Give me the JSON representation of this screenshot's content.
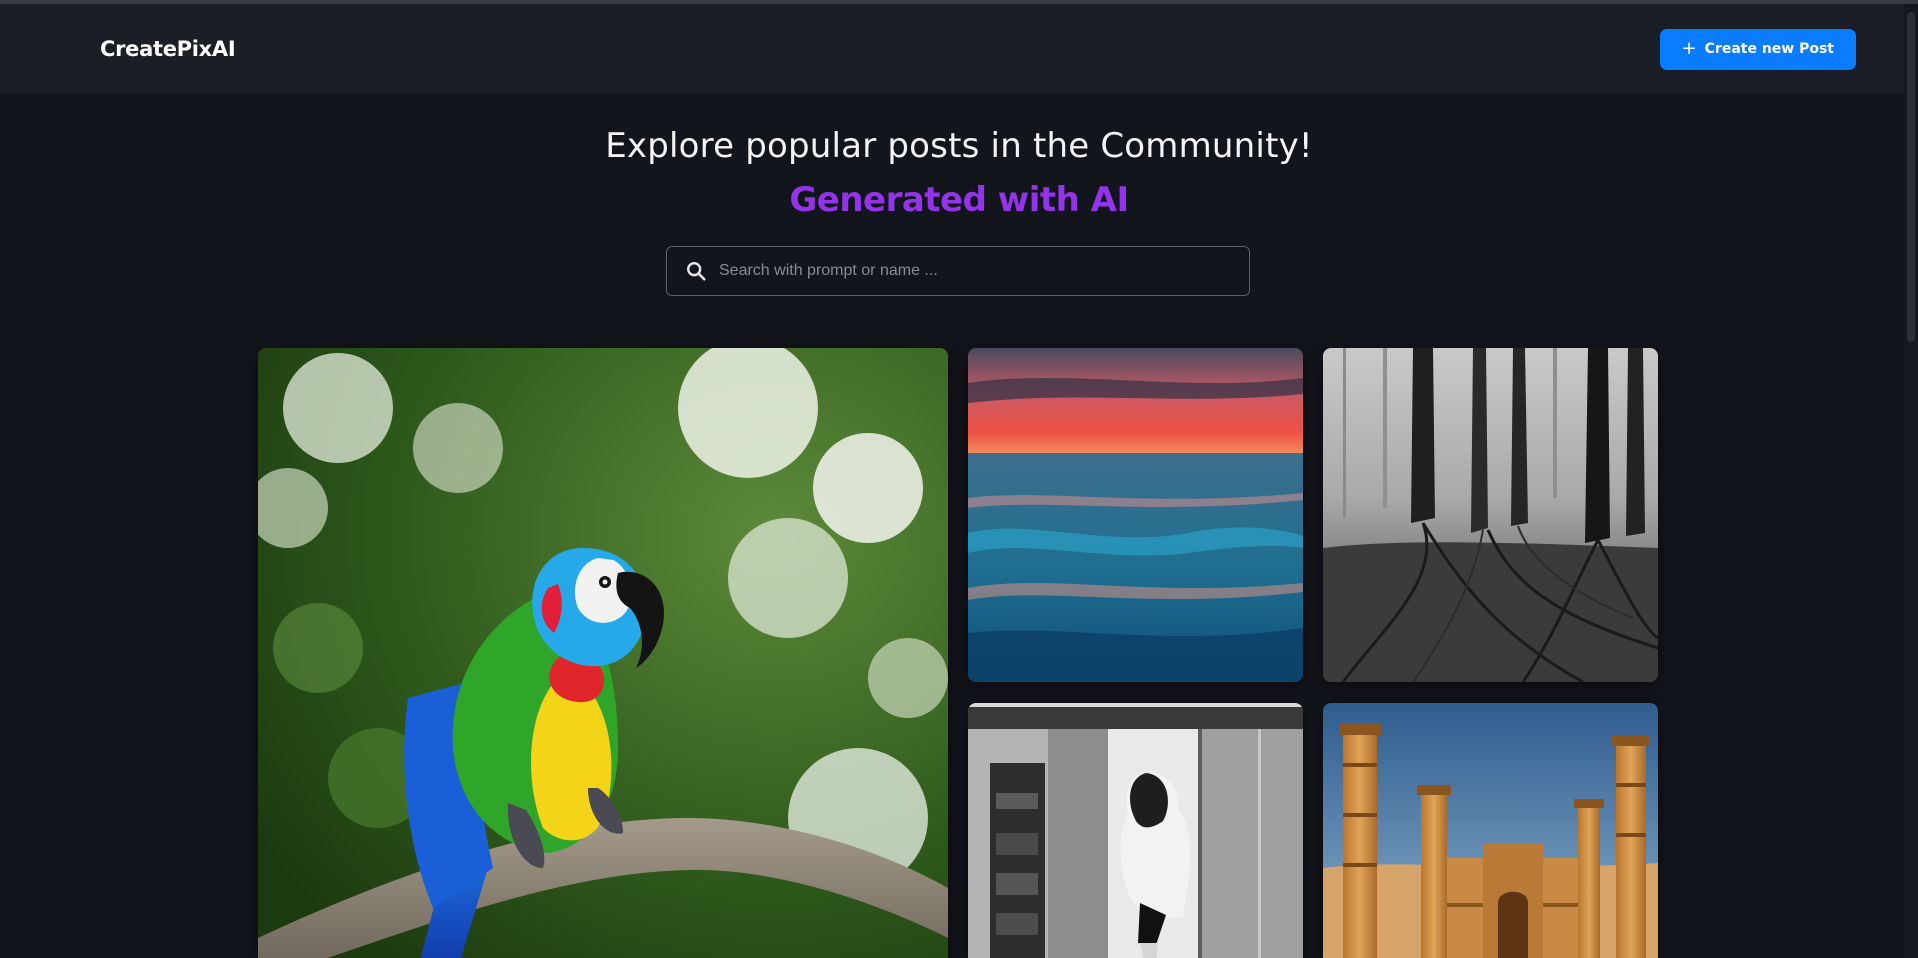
{
  "app": {
    "name": "CreatePixAI"
  },
  "header": {
    "create_button": {
      "label": "Create new Post",
      "icon": "plus-icon"
    }
  },
  "hero": {
    "title": "Explore popular posts in the Community!",
    "subtitle": "Generated with AI"
  },
  "search": {
    "placeholder": "Search with prompt or name ...",
    "value": "",
    "icon": "search-icon"
  },
  "colors": {
    "background": "#13151c",
    "header": "#1b1e27",
    "accent_button": "#0a7cff",
    "subtitle": "#9333ea"
  },
  "posts": [
    {
      "image": "parrot-macaw"
    },
    {
      "image": "ocean-sunset-waves"
    },
    {
      "image": "foggy-forest-bw"
    },
    {
      "image": "woman-doorway-bw"
    },
    {
      "image": "desert-minarets"
    }
  ]
}
